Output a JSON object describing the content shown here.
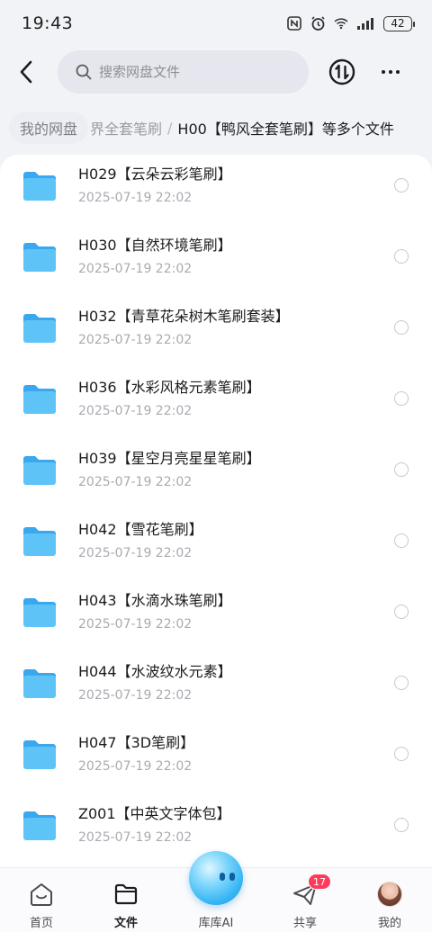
{
  "status_bar": {
    "time": "19:43",
    "battery": "42",
    "icons": [
      "nfc-icon",
      "alarm-icon",
      "wifi-icon",
      "signal-icon",
      "battery-icon"
    ]
  },
  "header": {
    "search_placeholder": "搜索网盘文件",
    "icons": [
      "back-arrow-icon",
      "search-icon",
      "transfer-icon",
      "more-icon"
    ]
  },
  "breadcrumb": {
    "root": "我的网盘",
    "middle": "界全套笔刷",
    "separator": "/",
    "current": "H00【鸭风全套笔刷】等多个文件"
  },
  "files": [
    {
      "name": "H029【云朵云彩笔刷】",
      "date": "2025-07-19  22:02"
    },
    {
      "name": "H030【自然环境笔刷】",
      "date": "2025-07-19  22:02"
    },
    {
      "name": "H032【青草花朵树木笔刷套装】",
      "date": "2025-07-19  22:02"
    },
    {
      "name": "H036【水彩风格元素笔刷】",
      "date": "2025-07-19  22:02"
    },
    {
      "name": "H039【星空月亮星星笔刷】",
      "date": "2025-07-19  22:02"
    },
    {
      "name": "H042【雪花笔刷】",
      "date": "2025-07-19  22:02"
    },
    {
      "name": "H043【水滴水珠笔刷】",
      "date": "2025-07-19  22:02"
    },
    {
      "name": "H044【水波纹水元素】",
      "date": "2025-07-19  22:02"
    },
    {
      "name": "H047【3D笔刷】",
      "date": "2025-07-19  22:02"
    },
    {
      "name": "Z001【中英文字体包】",
      "date": "2025-07-19  22:02"
    }
  ],
  "tab_bar": {
    "tabs": [
      {
        "label": "首页",
        "icon": "home-icon"
      },
      {
        "label": "文件",
        "icon": "folder-icon",
        "active": true
      },
      {
        "label": "库库AI",
        "icon": "ai-assistant-icon"
      },
      {
        "label": "共享",
        "icon": "share-icon",
        "badge": "17"
      },
      {
        "label": "我的",
        "icon": "avatar-icon"
      }
    ]
  },
  "colors": {
    "folder": "#55bdf6",
    "badge": "#ff3b5c",
    "background": "#f2f3f7",
    "accent": "#34b4f4"
  }
}
